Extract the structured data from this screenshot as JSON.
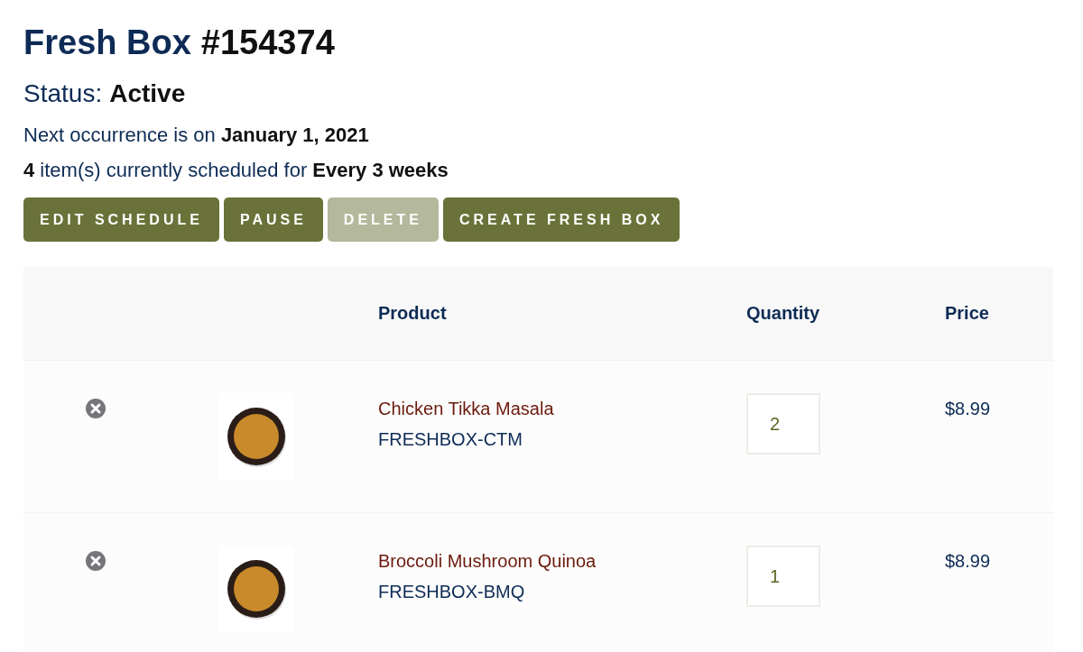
{
  "heading": {
    "title": "Fresh Box",
    "number": "#154374"
  },
  "status": {
    "label": "Status:",
    "value": "Active"
  },
  "next_occurrence": "Next occurrence is on **January 1, 2021**",
  "schedule_summary": "**4** item(s) currently scheduled for **Every 3 weeks**",
  "buttons": [
    {
      "label": "EDIT SCHEDULE",
      "disabled": false
    },
    {
      "label": "PAUSE",
      "disabled": false
    },
    {
      "label": "DELETE",
      "disabled": true
    },
    {
      "label": "CREATE FRESH BOX",
      "disabled": false
    }
  ],
  "table": {
    "columns": [
      "Product",
      "Quantity",
      "Price"
    ],
    "rows": [
      {
        "product": "Chicken Tikka Masala",
        "sku": "FRESHBOX-CTM",
        "quantity": "2",
        "price": "$8.99"
      },
      {
        "product": "Broccoli Mushroom Quinoa",
        "sku": "FRESHBOX-BMQ",
        "quantity": "1",
        "price": "$8.99"
      }
    ]
  }
}
